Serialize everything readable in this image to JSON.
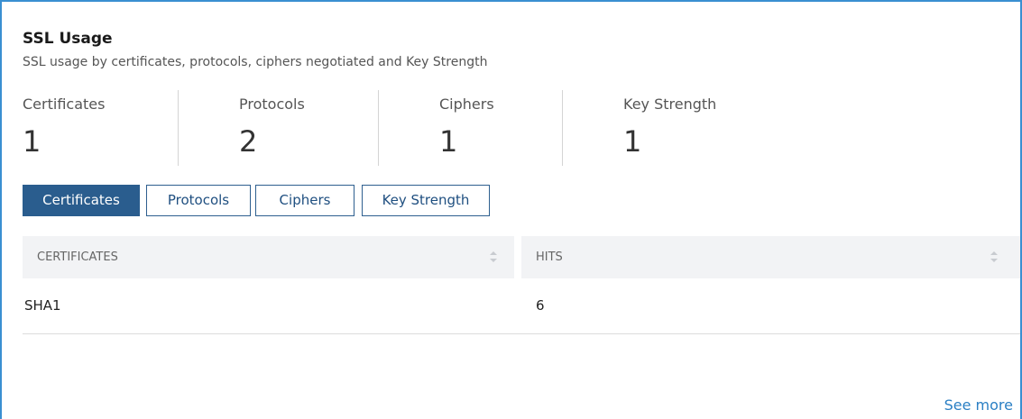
{
  "panel": {
    "title": "SSL Usage",
    "subtitle": "SSL usage by certificates, protocols, ciphers negotiated and Key Strength"
  },
  "metrics": [
    {
      "label": "Certificates",
      "value": "1"
    },
    {
      "label": "Protocols",
      "value": "2"
    },
    {
      "label": "Ciphers",
      "value": "1"
    },
    {
      "label": "Key Strength",
      "value": "1"
    }
  ],
  "tabs": [
    {
      "label": "Certificates",
      "active": true
    },
    {
      "label": "Protocols",
      "active": false
    },
    {
      "label": "Ciphers",
      "active": false
    },
    {
      "label": "Key Strength",
      "active": false
    }
  ],
  "table": {
    "columns": [
      "CERTIFICATES",
      "HITS"
    ],
    "rows": [
      [
        "SHA1",
        "6"
      ]
    ]
  },
  "footer": {
    "see_more": "See more"
  },
  "colors": {
    "accent_border": "#3a8fd1",
    "active_tab": "#2a5d8e",
    "link": "#2a7fc4",
    "header_bg": "#f2f3f5"
  }
}
